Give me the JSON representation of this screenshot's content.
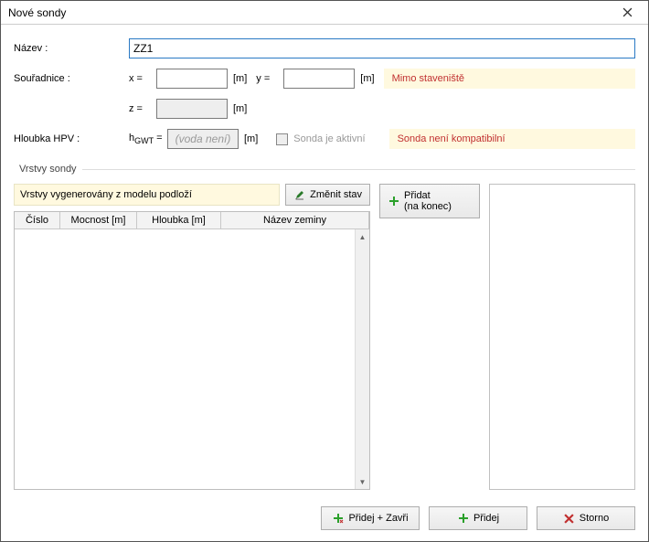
{
  "window": {
    "title": "Nové sondy"
  },
  "labels": {
    "name": "Název :",
    "coords": "Souřadnice :",
    "x": "x =",
    "y": "y =",
    "z": "z =",
    "m": "[m]",
    "depth_hpv": "Hloubka HPV :",
    "hgwt": "hGWT =",
    "inactive_checkbox": "Sonda je aktivní",
    "group_title": "Vrstvy sondy"
  },
  "values": {
    "name": "ZZ1",
    "x": "",
    "y": "",
    "z": "",
    "hgwt_placeholder": "(voda není)"
  },
  "warnings": {
    "outside": "Mimo staveniště",
    "incompat": "Sonda není kompatibilní"
  },
  "group": {
    "status": "Vrstvy vygenerovány z modelu podloží",
    "change_state": "Změnit stav",
    "add": "Přidat\n(na konec)",
    "add_line1": "Přidat",
    "add_line2": "(na konec)",
    "columns": {
      "c1": "Číslo",
      "c2": "Mocnost [m]",
      "c3": "Hloubka [m]",
      "c4": "Název zeminy"
    }
  },
  "footer": {
    "add_close": "Přidej + Zavři",
    "add": "Přidej",
    "cancel": "Storno"
  }
}
